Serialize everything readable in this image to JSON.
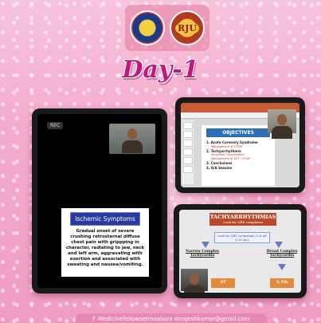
{
  "header": {
    "title": "Day-1"
  },
  "tablet_left": {
    "rec_label": "REC",
    "slide_heading": "Ischemic Symptoms",
    "slide_text": "Gradual onset of severe crushing retrosternal diffuse chest pain with grippping in character, radiating to jaw, neck and left arm, aggravating with exertion and associated with sweating and nausea/vomiting."
  },
  "tablet_top_right": {
    "slide_heading": "OBJECTIVES",
    "items": [
      {
        "label": "1. Acute Coronary Syndrome",
        "sub": "Management of STEMI"
      },
      {
        "label": "2. Tachyarrhythmia",
        "sub": "Simplified Classification"
      },
      {
        "label": "",
        "sub": "Management of SVT / VT/AF"
      },
      {
        "label": "3. Conclusions",
        "sub": ""
      },
      {
        "label": "4. Q/A Session",
        "sub": ""
      }
    ]
  },
  "tablet_bottom_right": {
    "heading": "TACHYARRHYTHMIAS",
    "subheading": "Look for QRS complexes",
    "look_note": "Look for QRS complexes (Cut-off 0.12 sec)",
    "left_branch": "Narrow Complex Tachycardia",
    "right_branch": "Broad Complex Tachycardia",
    "box_left": "VT",
    "box_right": "V. Fib"
  },
  "footer": {
    "text": "Medicinefellowsetmaalswa  drrajeshkumar@gmail.com"
  }
}
